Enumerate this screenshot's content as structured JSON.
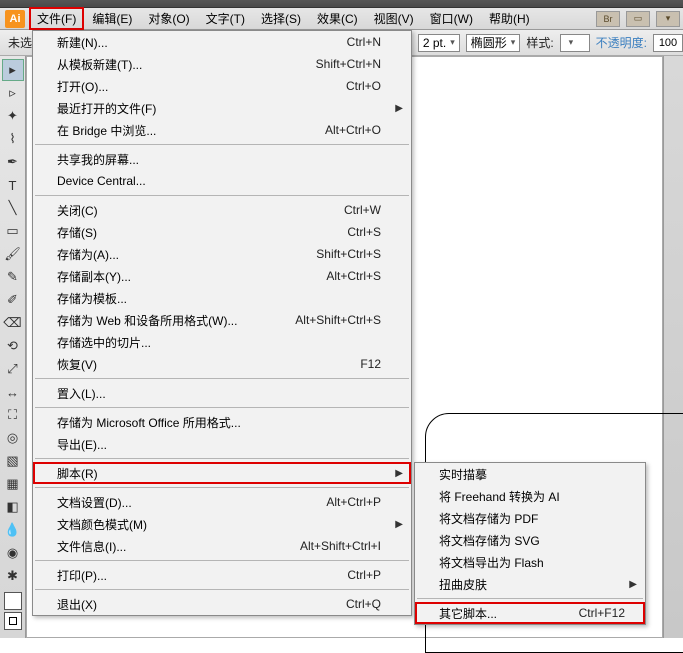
{
  "menubar": {
    "items": [
      "文件(F)",
      "编辑(E)",
      "对象(O)",
      "文字(T)",
      "选择(S)",
      "效果(C)",
      "视图(V)",
      "窗口(W)",
      "帮助(H)"
    ],
    "br": "Br"
  },
  "toolbar2": {
    "unlabeled": "未选",
    "stroke_val": "2 pt.",
    "shape": "椭圆形",
    "style_label": "样式:",
    "opacity_label": "不透明度:",
    "opacity_val": "100"
  },
  "file_menu": [
    {
      "label": "新建(N)...",
      "short": "Ctrl+N"
    },
    {
      "label": "从模板新建(T)...",
      "short": "Shift+Ctrl+N"
    },
    {
      "label": "打开(O)...",
      "short": "Ctrl+O"
    },
    {
      "label": "最近打开的文件(F)",
      "sub": true
    },
    {
      "label": "在 Bridge 中浏览...",
      "short": "Alt+Ctrl+O"
    },
    {
      "sep": true
    },
    {
      "label": "共享我的屏幕..."
    },
    {
      "label": "Device Central..."
    },
    {
      "sep": true
    },
    {
      "label": "关闭(C)",
      "short": "Ctrl+W"
    },
    {
      "label": "存储(S)",
      "short": "Ctrl+S"
    },
    {
      "label": "存储为(A)...",
      "short": "Shift+Ctrl+S"
    },
    {
      "label": "存储副本(Y)...",
      "short": "Alt+Ctrl+S"
    },
    {
      "label": "存储为模板..."
    },
    {
      "label": "存储为 Web 和设备所用格式(W)...",
      "short": "Alt+Shift+Ctrl+S"
    },
    {
      "label": "存储选中的切片..."
    },
    {
      "label": "恢复(V)",
      "short": "F12"
    },
    {
      "sep": true
    },
    {
      "label": "置入(L)..."
    },
    {
      "sep": true
    },
    {
      "label": "存储为 Microsoft Office 所用格式..."
    },
    {
      "label": "导出(E)..."
    },
    {
      "sep": true
    },
    {
      "label": "脚本(R)",
      "sub": true,
      "hl": true
    },
    {
      "sep": true
    },
    {
      "label": "文档设置(D)...",
      "short": "Alt+Ctrl+P"
    },
    {
      "label": "文档颜色模式(M)",
      "sub": true
    },
    {
      "label": "文件信息(I)...",
      "short": "Alt+Shift+Ctrl+I"
    },
    {
      "sep": true
    },
    {
      "label": "打印(P)...",
      "short": "Ctrl+P"
    },
    {
      "sep": true
    },
    {
      "label": "退出(X)",
      "short": "Ctrl+Q"
    }
  ],
  "script_menu": [
    {
      "label": "实时描摹"
    },
    {
      "label": "将 Freehand 转换为 AI"
    },
    {
      "label": "将文档存储为 PDF"
    },
    {
      "label": "将文档存储为 SVG"
    },
    {
      "label": "将文档导出为 Flash"
    },
    {
      "label": "扭曲皮肤",
      "sub": true
    },
    {
      "sep": true
    },
    {
      "label": "其它脚本...",
      "short": "Ctrl+F12",
      "hl": true
    }
  ],
  "app_icon": "Ai"
}
